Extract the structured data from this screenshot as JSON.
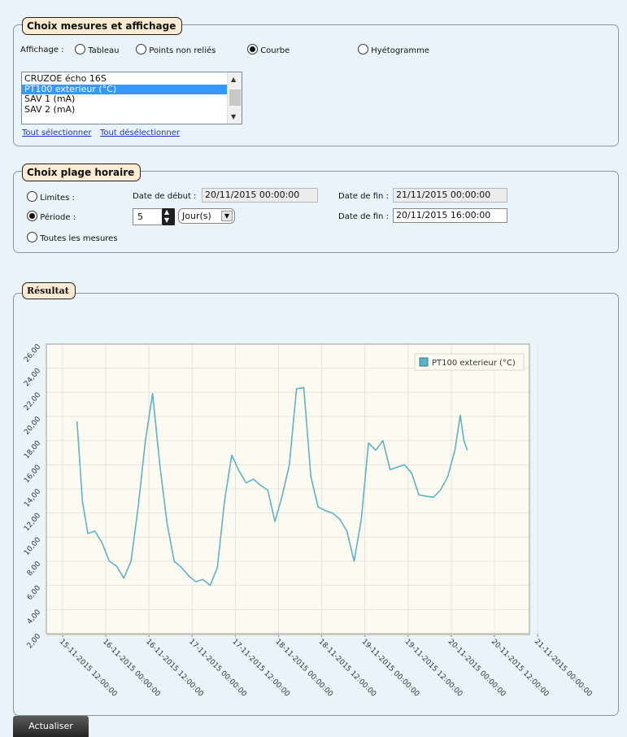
{
  "section1": {
    "legend": "Choix mesures et affichage",
    "affichage_label": "Affichage :",
    "options": [
      "Tableau",
      "Points non reliés",
      "Courbe",
      "Hyétogramme"
    ],
    "selected_option": "Courbe",
    "list_items": [
      "CRUZOE écho 16S",
      "PT100 exterieur (°C)",
      "SAV 1 (mA)",
      "SAV 2 (mA)"
    ],
    "selected_item": "PT100 exterieur (°C)",
    "select_all": "Tout sélectionner",
    "deselect_all": "Tout désélectionner"
  },
  "section2": {
    "legend": "Choix plage horaire",
    "limites_label": "Limites :",
    "periode_label": "Période :",
    "toutes_label": "Toutes les mesures",
    "date_debut_label": "Date de début :",
    "date_debut_value": "20/11/2015 00:00:00",
    "date_fin_label": "Date de fin :",
    "date_fin_limits_value": "21/11/2015 00:00:00",
    "date_fin_periode_value": "20/11/2015 16:00:00",
    "period_value": "5",
    "period_unit": "Jour(s)",
    "selected_mode": "Période"
  },
  "section3": {
    "legend": "Résultat"
  },
  "refresh_button": "Actualiser",
  "chart_data": {
    "type": "line",
    "title": "",
    "ylim": [
      2,
      26
    ],
    "y_ticks": [
      "2,00",
      "4,00",
      "6,00",
      "8,00",
      "10,00",
      "12,00",
      "14,00",
      "16,00",
      "18,00",
      "20,00",
      "22,00",
      "24,00",
      "26,00"
    ],
    "x_ticks": [
      "15-11-2015 12:00:00",
      "16-11-2015 00:00:00",
      "16-11-2015 12:00:00",
      "17-11-2015 00:00:00",
      "17-11-2015 12:00:00",
      "18-11-2015 00:00:00",
      "18-11-2015 12:00:00",
      "19-11-2015 00:00:00",
      "19-11-2015 12:00:00",
      "20-11-2015 00:00:00",
      "20-11-2015 12:00:00",
      "21-11-2015 00:00:00"
    ],
    "x_range": [
      "15-11-2015 12:00:00",
      "20-11-2015 18:00:00"
    ],
    "series": [
      {
        "name": "PT100 exterieur (°C)",
        "color": "#5bb3c5",
        "points": [
          [
            "15-11-2015 16:00",
            19.6
          ],
          [
            "15-11-2015 17:30",
            13.0
          ],
          [
            "15-11-2015 19:00",
            10.3
          ],
          [
            "15-11-2015 21:00",
            10.5
          ],
          [
            "15-11-2015 23:00",
            9.5
          ],
          [
            "16-11-2015 01:00",
            8.0
          ],
          [
            "16-11-2015 03:00",
            7.6
          ],
          [
            "16-11-2015 05:00",
            6.6
          ],
          [
            "16-11-2015 07:00",
            8.0
          ],
          [
            "16-11-2015 09:00",
            12.5
          ],
          [
            "16-11-2015 11:00",
            18.0
          ],
          [
            "16-11-2015 13:00",
            21.9
          ],
          [
            "16-11-2015 15:00",
            16.0
          ],
          [
            "16-11-2015 17:00",
            11.2
          ],
          [
            "16-11-2015 19:00",
            8.0
          ],
          [
            "16-11-2015 21:00",
            7.5
          ],
          [
            "16-11-2015 23:00",
            6.8
          ],
          [
            "17-11-2015 01:00",
            6.3
          ],
          [
            "17-11-2015 03:00",
            6.5
          ],
          [
            "17-11-2015 05:00",
            6.0
          ],
          [
            "17-11-2015 07:00",
            7.5
          ],
          [
            "17-11-2015 09:00",
            13.0
          ],
          [
            "17-11-2015 11:00",
            16.8
          ],
          [
            "17-11-2015 13:00",
            15.5
          ],
          [
            "17-11-2015 15:00",
            14.5
          ],
          [
            "17-11-2015 17:00",
            14.8
          ],
          [
            "17-11-2015 19:00",
            14.3
          ],
          [
            "17-11-2015 21:00",
            13.9
          ],
          [
            "17-11-2015 23:00",
            11.3
          ],
          [
            "18-11-2015 01:00",
            13.4
          ],
          [
            "18-11-2015 03:00",
            16.0
          ],
          [
            "18-11-2015 05:00",
            22.3
          ],
          [
            "18-11-2015 07:00",
            22.4
          ],
          [
            "18-11-2015 09:00",
            15.0
          ],
          [
            "18-11-2015 11:00",
            12.5
          ],
          [
            "18-11-2015 13:00",
            12.2
          ],
          [
            "18-11-2015 15:00",
            12.0
          ],
          [
            "18-11-2015 17:00",
            11.5
          ],
          [
            "18-11-2015 19:00",
            10.5
          ],
          [
            "18-11-2015 21:00",
            8.0
          ],
          [
            "18-11-2015 23:00",
            11.5
          ],
          [
            "19-11-2015 01:00",
            17.8
          ],
          [
            "19-11-2015 03:00",
            17.2
          ],
          [
            "19-11-2015 05:00",
            18.0
          ],
          [
            "19-11-2015 07:00",
            15.6
          ],
          [
            "19-11-2015 09:00",
            15.8
          ],
          [
            "19-11-2015 11:00",
            16.0
          ],
          [
            "19-11-2015 13:00",
            15.3
          ],
          [
            "19-11-2015 15:00",
            13.5
          ],
          [
            "19-11-2015 17:00",
            13.4
          ],
          [
            "19-11-2015 19:00",
            13.3
          ],
          [
            "19-11-2015 21:00",
            13.9
          ],
          [
            "19-11-2015 23:00",
            15.0
          ],
          [
            "20-11-2015 01:00",
            17.2
          ],
          [
            "20-11-2015 02:30",
            20.1
          ],
          [
            "20-11-2015 03:30",
            18.0
          ],
          [
            "20-11-2015 04:30",
            17.2
          ]
        ]
      }
    ],
    "legend_position": "top-right",
    "grid": true
  }
}
